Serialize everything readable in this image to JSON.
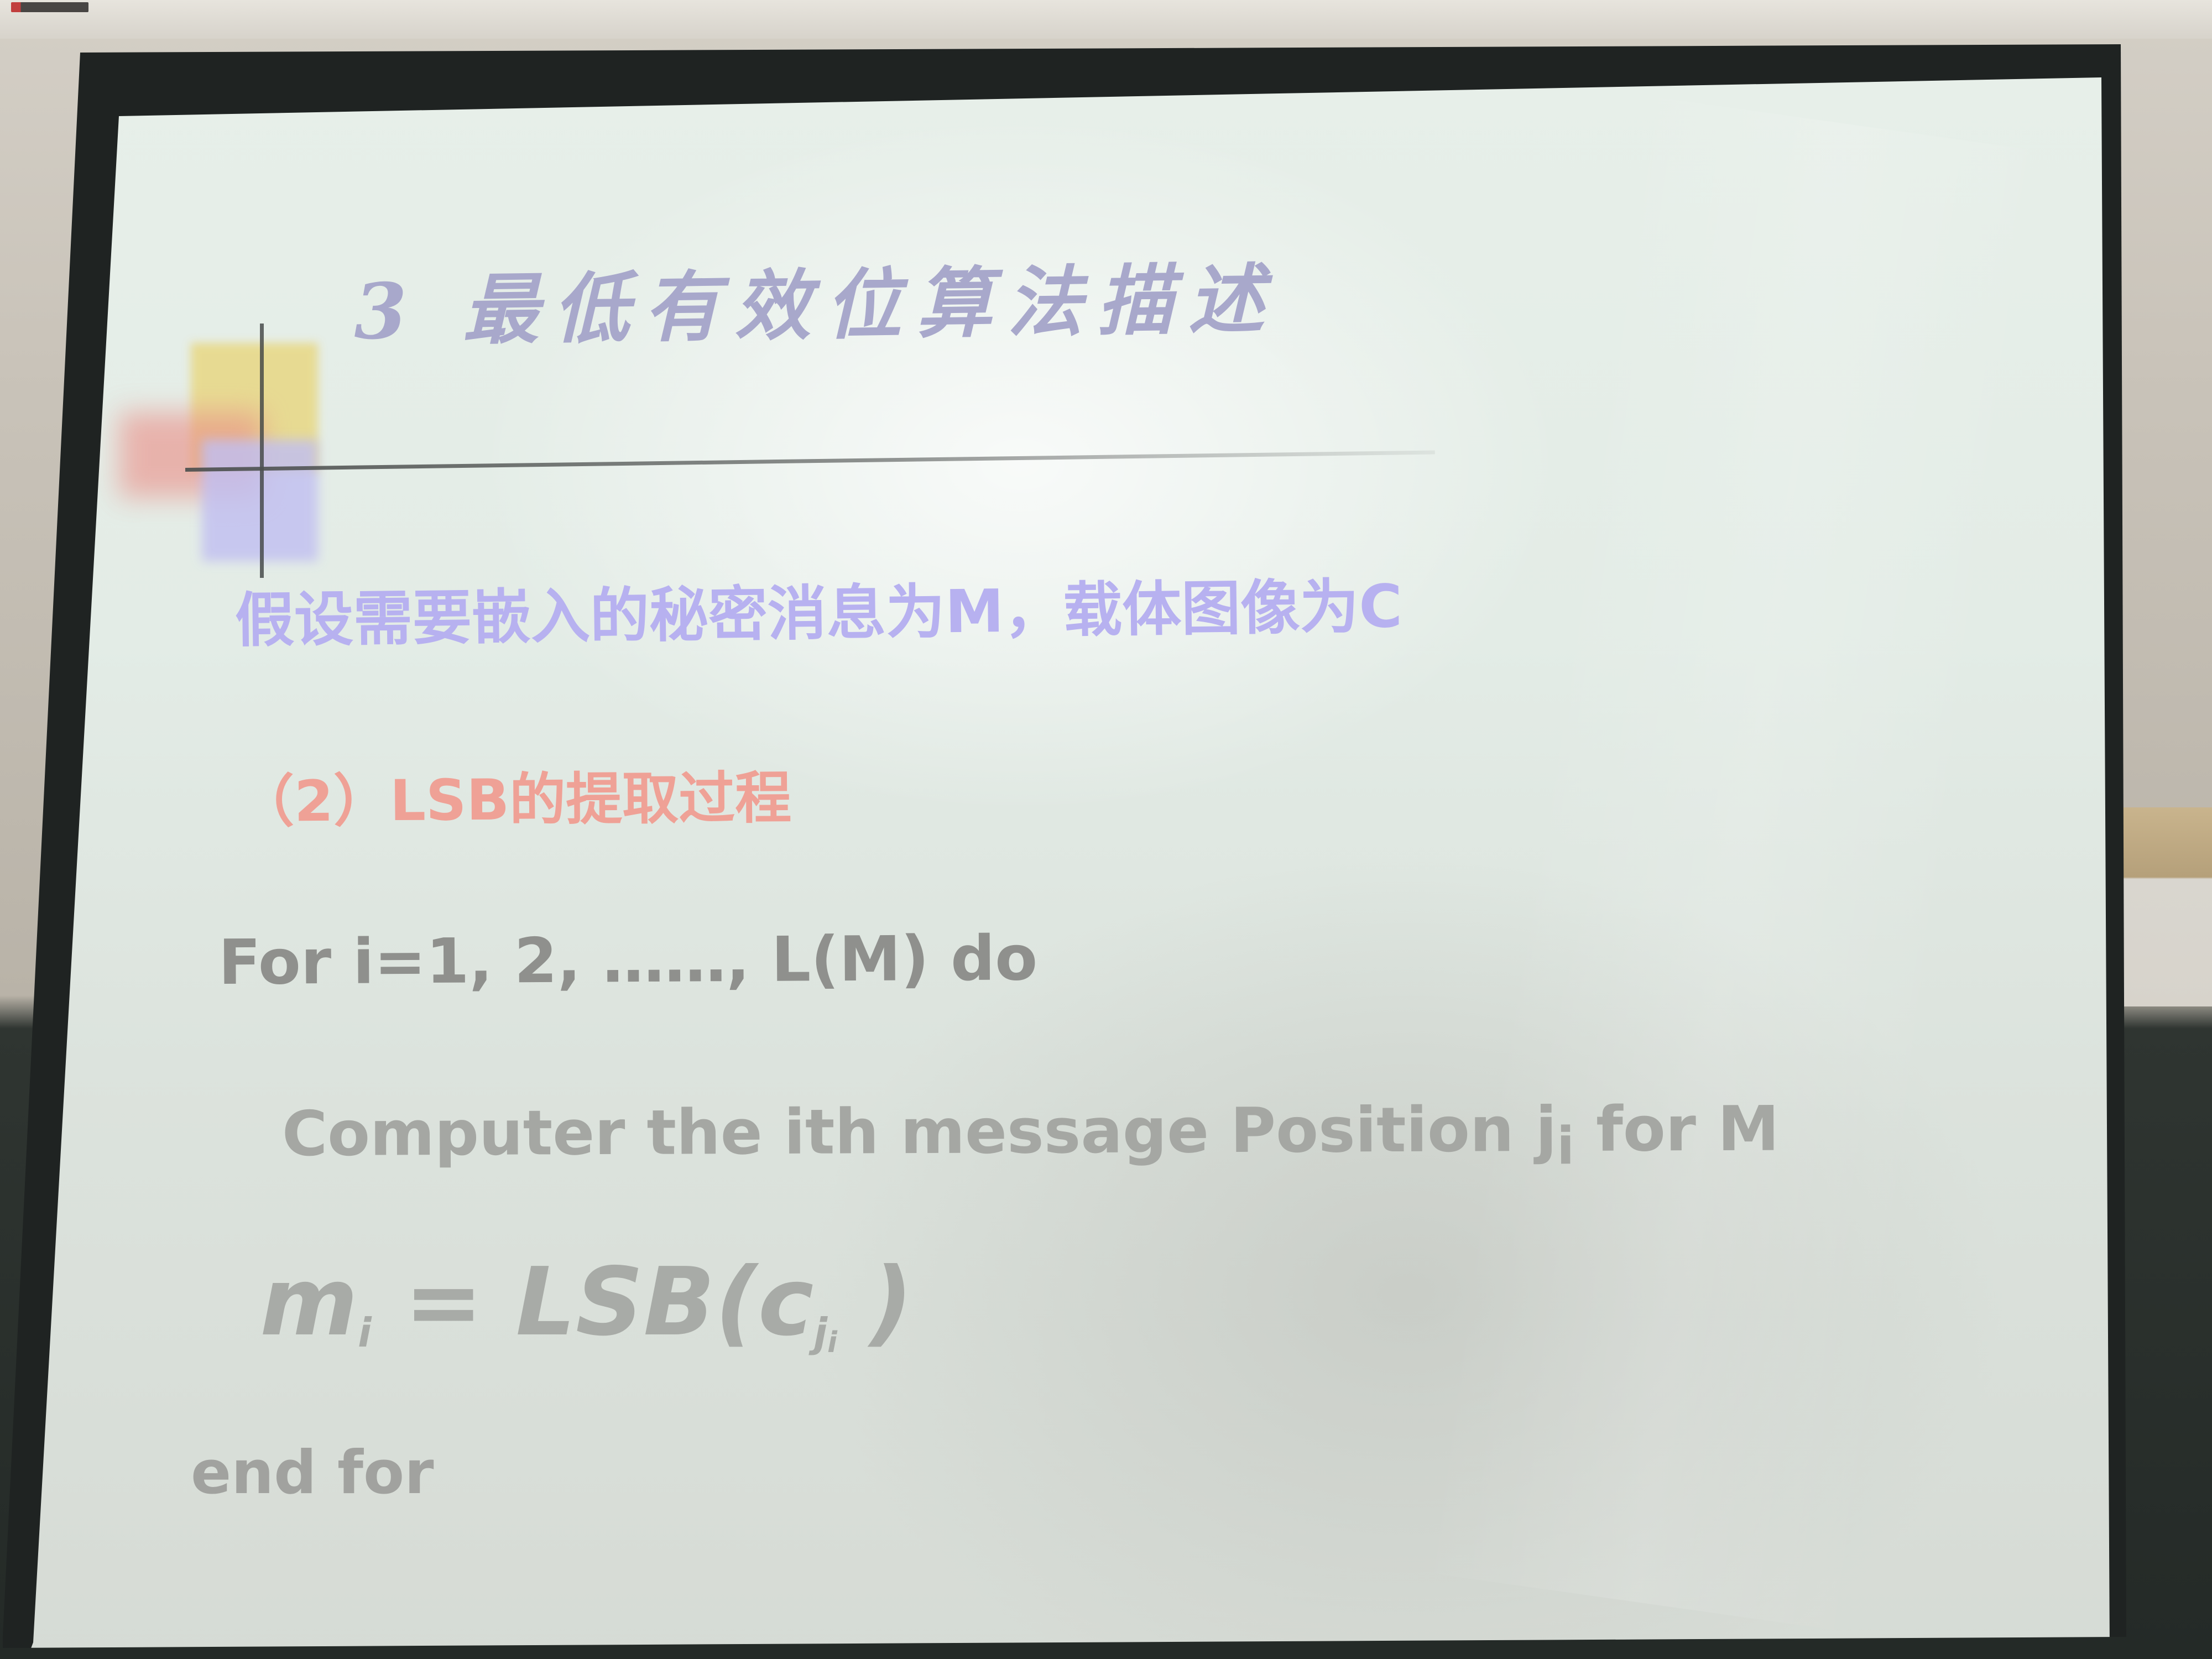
{
  "slide": {
    "heading": "3  最低有效位算法描述",
    "assumption": "假设需要嵌入的秘密消息为M，载体图像为C",
    "process_heading": "（2）LSB的提取过程",
    "for_line": "For  i=1, 2, ……, L(M) do",
    "compute": {
      "prefix": "Computer the ith message Position j",
      "subscript": "i",
      "suffix": " for  M"
    },
    "formula": {
      "m": "m",
      "m_sub": "i",
      "equals": " = LSB(c",
      "c_sub": "j",
      "c_sub_sub": "i",
      "close": " )"
    },
    "end_line": "end for"
  },
  "colors": {
    "screen_background": "#e3ece6",
    "heading": "#a8a8cb",
    "assumption_text": "#b7b1f0",
    "process_heading_text": "#efa196",
    "body_text": "#a5a7a3",
    "decor_yellow": "#e8d780",
    "decor_pink": "#ea8f88",
    "decor_lavender": "#c1bff1"
  }
}
